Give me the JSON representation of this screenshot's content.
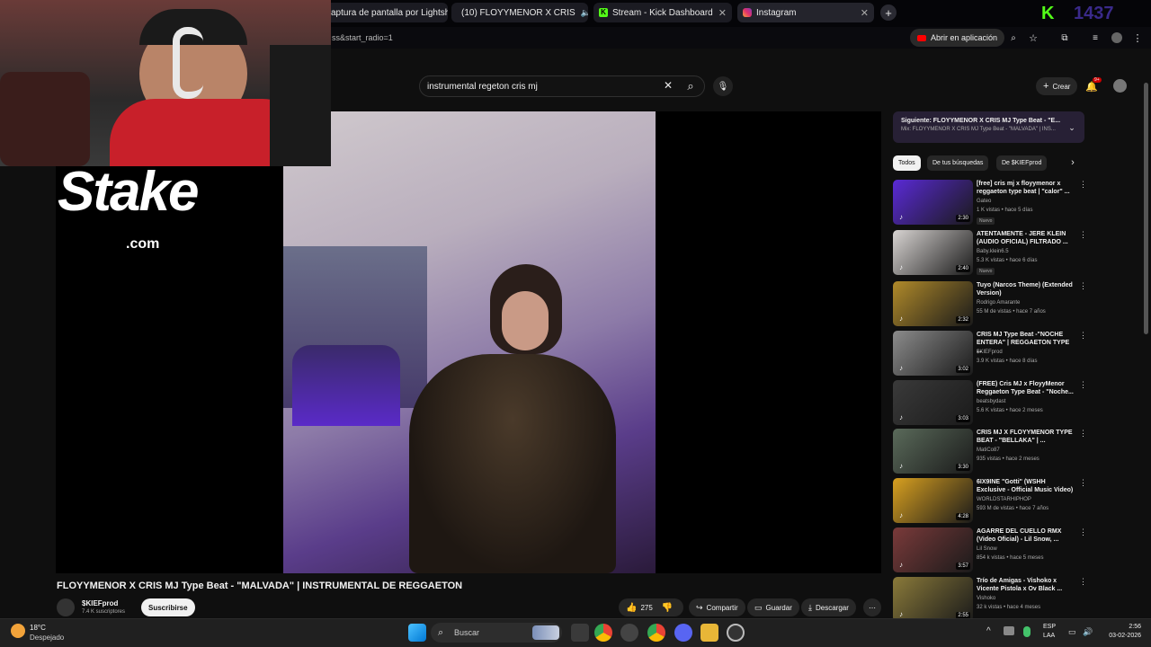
{
  "browser": {
    "tabs": [
      {
        "label": "aptura de pantalla por Lightsh",
        "icon": "screenshot-icon"
      },
      {
        "label": "(10) FLOYYMENOR X CRIS",
        "icon": "youtube-icon"
      },
      {
        "label": "Stream - Kick Dashboard",
        "icon": "kick-icon"
      },
      {
        "label": "Instagram",
        "icon": "instagram-icon"
      }
    ],
    "url_fragment": "ss&start_radio=1",
    "open_in_app": "Abrir en aplicación",
    "kick_counter": "1437"
  },
  "youtube": {
    "search_value": "instrumental regeton cris mj",
    "create_label": "Crear",
    "notif_badge": "9+",
    "overlay_brand": "Stake",
    "overlay_brand_sub": ".com",
    "video_title": "FLOYYMENOR X CRIS MJ Type Beat - \"MALVADA\" | INSTRUMENTAL DE REGGAETON",
    "channel": {
      "name": "$KIEFprod",
      "subs": "7.4 K suscriptores",
      "subscribe": "Suscribirse"
    },
    "actions": {
      "likes": "275",
      "share": "Compartir",
      "save": "Guardar",
      "download": "Descargar"
    },
    "next": {
      "line1": "Siguiente: FLOYYMENOR X CRIS MJ Type Beat - \"E...",
      "line2": "Mix: FLOYYMENOR X CRIS MJ Type Beat - \"MALVADA\" | INS..."
    },
    "chips": [
      "Todos",
      "De tus búsquedas",
      "De $KIEFprod"
    ],
    "recommendations": [
      {
        "title": "[free] cris mj x floyymenor x reggaeton type beat | \"calor\" ...",
        "channel": "Gateo",
        "meta": "1 K vistas • hace 5 días",
        "duration": "2:30",
        "badge": "Nuevo",
        "color": "#5a2ad6"
      },
      {
        "title": "ATENTAMENTE - JERE KLEIN (AUDIO OFICIAL) FILTRADO ...",
        "channel": "Baby.klein6.5",
        "meta": "5.3 K vistas • hace 6 días",
        "duration": "2:40",
        "badge": "Nuevo",
        "color": "#d8d4d2"
      },
      {
        "title": "Tuyo (Narcos Theme) (Extended Version)",
        "channel": "Rodrigo Amarante",
        "meta": "55 M de vistas • hace 7 años",
        "duration": "2:32",
        "badge": "",
        "color": "#b08a2a"
      },
      {
        "title": "CRIS MJ Type Beat -\"NOCHE ENTERA\" | REGGAETON TYPE ...",
        "channel": "$KIEFprod",
        "meta": "3.9 K vistas • hace 8 días",
        "duration": "3:02",
        "badge": "",
        "color": "#8c8c8c"
      },
      {
        "title": "(FREE) Cris MJ x FloyyMenor Reggaeton Type Beat - \"Noche...",
        "channel": "beatsbydast",
        "meta": "5.6 K vistas • hace 2 meses",
        "duration": "3:03",
        "badge": "",
        "color": "#3a3a3a"
      },
      {
        "title": "CRIS MJ X FLOYYMENOR TYPE BEAT - \"BELLAKA\" | ...",
        "channel": "MatiCo87",
        "meta": "935 vistas • hace 2 meses",
        "duration": "3:30",
        "badge": "",
        "color": "#5a6a5a"
      },
      {
        "title": "6IX9INE \"Gotti\" (WSHH Exclusive - Official Music Video)",
        "channel": "WORLDSTARHIPHOP",
        "meta": "593 M de vistas • hace 7 años",
        "duration": "4:28",
        "badge": "",
        "color": "#d8a020"
      },
      {
        "title": "AGARRE DEL CUELLO RMX (Video Oficial) - Lil Snow, ...",
        "channel": "Lil Snow",
        "meta": "854 k vistas • hace 5 meses",
        "duration": "3:57",
        "badge": "",
        "color": "#7a3a3a"
      },
      {
        "title": "Trío de Amigas - Vishoko x Vicente Pistola x Ov Black ...",
        "channel": "Vishoko",
        "meta": "32 k vistas • hace 4 meses",
        "duration": "2:55",
        "badge": "",
        "color": "#8a7a3a"
      }
    ]
  },
  "taskbar": {
    "weather_temp": "18°C",
    "weather_desc": "Despejado",
    "search": "Buscar",
    "lang1": "ESP",
    "lang2": "LAA",
    "time": "2:56",
    "date": "03-02-2026"
  }
}
